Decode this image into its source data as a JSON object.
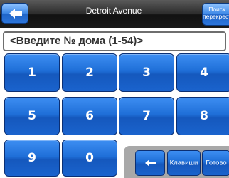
{
  "header": {
    "title": "Detroit Avenue",
    "search_label_line1": "Поиск",
    "search_label_line2": "перекрест"
  },
  "input": {
    "placeholder_text": "<Введите № дома (1-54)>"
  },
  "keypad": {
    "keys": [
      "1",
      "2",
      "3",
      "4",
      "5",
      "6",
      "7",
      "8",
      "9",
      "0"
    ]
  },
  "actions": {
    "keyboards_label": "Клавиши",
    "done_label": "Готово"
  },
  "icons": {
    "back": "left-arrow-icon",
    "backspace": "backspace-arrow-icon"
  },
  "colors": {
    "key_blue": "#1f6fd8",
    "top_bar": "#2c2c2c",
    "panel_grey": "#a8a8a8"
  }
}
